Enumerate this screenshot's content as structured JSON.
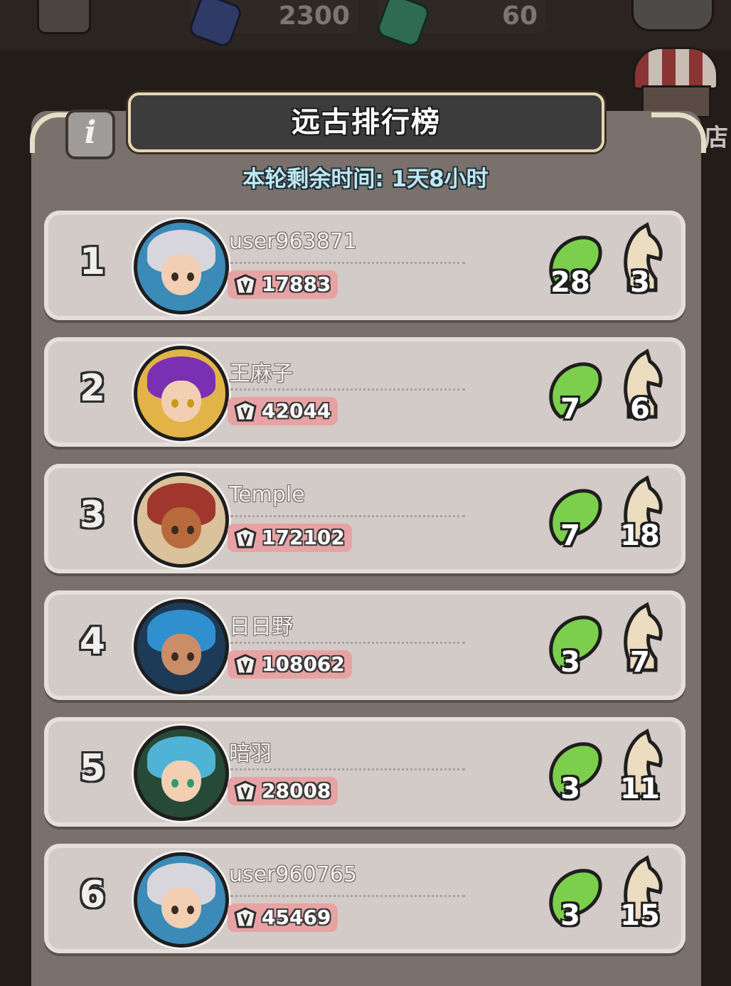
{
  "top_bar": {
    "resource1_value": "2300",
    "resource2_value": "60",
    "colors": {
      "resource1_gem": "#2f3a66",
      "resource2_gem": "#2f6b52"
    }
  },
  "shop": {
    "label": "店"
  },
  "leaderboard": {
    "title": "远古排行榜",
    "time_remaining_label": "本轮剩余时间: ",
    "time_remaining_value": "1天8小时",
    "rows": [
      {
        "rank": "1",
        "name": "user963871",
        "power": "17883",
        "seeds": "28",
        "knights": "3",
        "avatar_hair": "#d6d6dc"
      },
      {
        "rank": "2",
        "name": "王麻子",
        "power": "42044",
        "seeds": "7",
        "knights": "6",
        "avatar_hair": "#7b2fb3"
      },
      {
        "rank": "3",
        "name": "Temple",
        "power": "172102",
        "seeds": "7",
        "knights": "18",
        "avatar_hair": "#a0362e"
      },
      {
        "rank": "4",
        "name": "日日野",
        "power": "108062",
        "seeds": "3",
        "knights": "7",
        "avatar_hair": "#2f8fcf"
      },
      {
        "rank": "5",
        "name": "暗羽",
        "power": "28008",
        "seeds": "3",
        "knights": "11",
        "avatar_hair": "#4fb3d6"
      },
      {
        "rank": "6",
        "name": "user960765",
        "power": "45469",
        "seeds": "3",
        "knights": "15",
        "avatar_hair": "#d6d6dc"
      }
    ]
  },
  "colors": {
    "panel": "#7b716c",
    "row": "#d3cbc7",
    "power_badge": "#e7a3a3",
    "seed_green": "#7ccf4c",
    "knight_beige": "#ecdcc0",
    "timer_text": "#bfe7f1"
  },
  "icons": [
    "info-icon",
    "seed-icon",
    "knight-icon",
    "power-icon",
    "shop-icon",
    "mail-icon"
  ]
}
